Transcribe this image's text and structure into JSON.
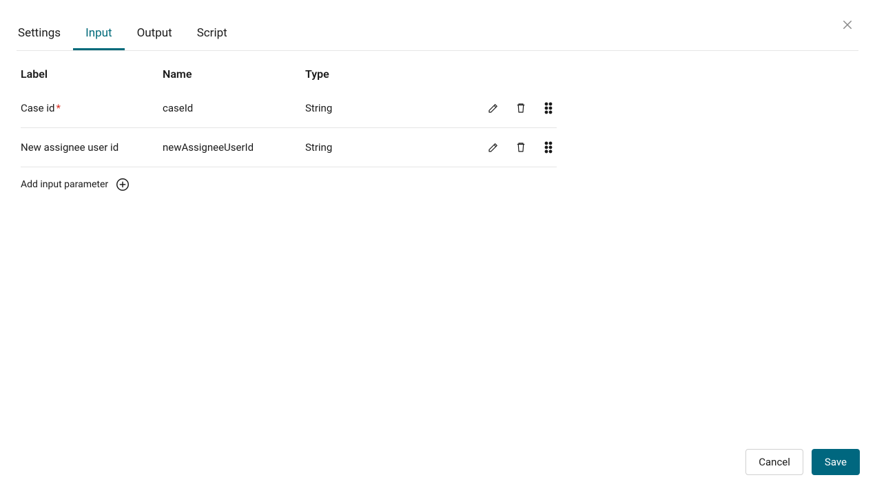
{
  "tabs": [
    {
      "label": "Settings",
      "active": false
    },
    {
      "label": "Input",
      "active": true
    },
    {
      "label": "Output",
      "active": false
    },
    {
      "label": "Script",
      "active": false
    }
  ],
  "table": {
    "headers": {
      "label": "Label",
      "name": "Name",
      "type": "Type"
    },
    "rows": [
      {
        "label": "Case id",
        "required": true,
        "name": "caseId",
        "type": "String"
      },
      {
        "label": "New assignee user id",
        "required": false,
        "name": "newAssigneeUserId",
        "type": "String"
      }
    ]
  },
  "add_parameter_label": "Add input parameter",
  "footer": {
    "cancel": "Cancel",
    "save": "Save"
  },
  "required_marker": "*"
}
